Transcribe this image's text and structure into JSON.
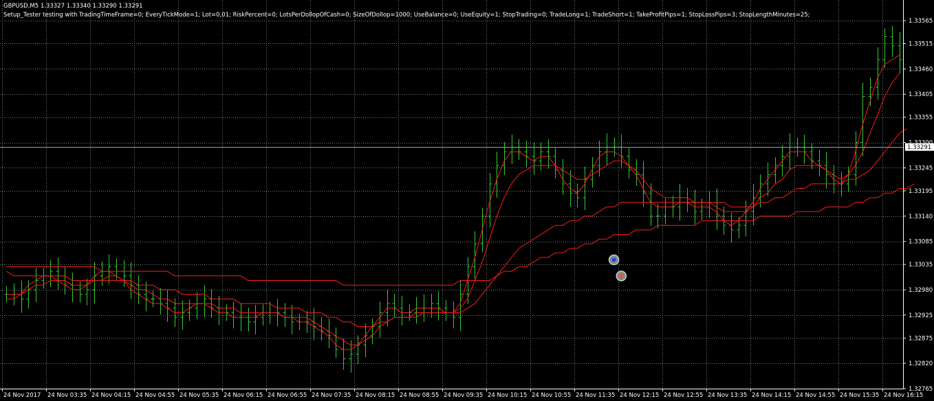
{
  "header": {
    "symbol_line": "GBPUSD,M5  1.33327 1.33340 1.33290 1.33291",
    "params_line": "Setup_Tester testing with TradingTimeFrame=0; EveryTickMode=1; Lot=0,01; RiskPercent=0; LotsPerDollopOfCash=0; SizeOfDollop=1000; UseBalance=0; UseEquity=1; StopTrading=0; TradeLong=1; TradeShort=1; TakeProfitPips=1; StopLossPips=3; StopLengthMinutes=25;"
  },
  "colors": {
    "background": "#000000",
    "bars": "#33cc33",
    "ma": "#ff1a1a",
    "grid": "#6f7f7f",
    "axis": "#ffffff",
    "price_line": "#9aa0a0",
    "price_tag_bg": "#ffffff"
  },
  "chart_data": {
    "type": "line",
    "symbol": "GBPUSD",
    "timeframe": "M5",
    "ohlc_last": {
      "open": 1.33327,
      "high": 1.3334,
      "low": 1.3329,
      "close": 1.33291
    },
    "current_price": "1.33291",
    "y_ticks": [
      "1.33565",
      "1.33515",
      "1.33460",
      "1.33405",
      "1.33355",
      "1.33300",
      "1.33245",
      "1.33195",
      "1.33140",
      "1.33085",
      "1.33035",
      "1.32980",
      "1.32925",
      "1.32875",
      "1.32820",
      "1.32765"
    ],
    "ylim": [
      1.32765,
      1.33565
    ],
    "x_ticks": [
      "24 Nov 2017",
      "24 Nov 03:35",
      "24 Nov 04:15",
      "24 Nov 04:55",
      "24 Nov 05:35",
      "24 Nov 06:15",
      "24 Nov 06:55",
      "24 Nov 07:35",
      "24 Nov 08:15",
      "24 Nov 08:55",
      "24 Nov 09:35",
      "24 Nov 10:15",
      "24 Nov 10:55",
      "24 Nov 11:35",
      "24 Nov 12:15",
      "24 Nov 12:55",
      "24 Nov 13:35",
      "24 Nov 14:15",
      "24 Nov 14:55",
      "24 Nov 15:35",
      "24 Nov 16:15"
    ],
    "bar_step_minutes": 5,
    "grid": true,
    "series": [
      {
        "kind": "price",
        "values": [
          1.3297,
          1.3297,
          1.3296,
          1.3298,
          1.33,
          1.3301,
          1.3302,
          1.3301,
          1.3299,
          1.3298,
          1.3297,
          1.3298,
          1.3301,
          1.3302,
          1.3303,
          1.3302,
          1.3301,
          1.3299,
          1.3297,
          1.3296,
          1.3296,
          1.3295,
          1.3294,
          1.3292,
          1.3293,
          1.3294,
          1.3295,
          1.3296,
          1.3294,
          1.3293,
          1.3293,
          1.3292,
          1.3292,
          1.3291,
          1.3292,
          1.3293,
          1.3293,
          1.3293,
          1.3292,
          1.3291,
          1.3291,
          1.3291,
          1.329,
          1.3289,
          1.3288,
          1.3285,
          1.3283,
          1.3284,
          1.3286,
          1.3288,
          1.329,
          1.3293,
          1.3295,
          1.3294,
          1.3293,
          1.3293,
          1.3294,
          1.3294,
          1.3295,
          1.3294,
          1.3293,
          1.3292,
          1.3297,
          1.3303,
          1.3308,
          1.3314,
          1.3321,
          1.3325,
          1.3328,
          1.3329,
          1.3328,
          1.3327,
          1.3326,
          1.3328,
          1.3327,
          1.3324,
          1.3321,
          1.3319,
          1.3318,
          1.3322,
          1.3325,
          1.3328,
          1.3329,
          1.3329,
          1.3327,
          1.3324,
          1.3323,
          1.3319,
          1.3314,
          1.3314,
          1.3316,
          1.3316,
          1.3318,
          1.3317,
          1.3315,
          1.3316,
          1.3317,
          1.3314,
          1.3312,
          1.3311,
          1.3312,
          1.3315,
          1.3318,
          1.3321,
          1.3323,
          1.3325,
          1.3327,
          1.3329,
          1.3329,
          1.3328,
          1.3326,
          1.3325,
          1.3323,
          1.3321,
          1.3321,
          1.3323,
          1.333,
          1.334,
          1.3342,
          1.3348,
          1.3353,
          1.3351,
          1.3348
        ]
      },
      {
        "kind": "moving_average",
        "name": "",
        "values": [
          1.3296,
          1.3296,
          1.3297,
          1.3299,
          1.33,
          1.3301,
          1.3301,
          1.33,
          1.3299,
          1.3298,
          1.3298,
          1.3299,
          1.3301,
          1.3302,
          1.3302,
          1.3301,
          1.33,
          1.3298,
          1.3297,
          1.3296,
          1.3295,
          1.3295,
          1.3294,
          1.3293,
          1.3293,
          1.3294,
          1.3295,
          1.3295,
          1.3294,
          1.3293,
          1.3293,
          1.3292,
          1.3292,
          1.3292,
          1.3292,
          1.3293,
          1.3293,
          1.3293,
          1.3292,
          1.3292,
          1.3291,
          1.3291,
          1.329,
          1.3289,
          1.3288,
          1.3286,
          1.3285,
          1.3285,
          1.3286,
          1.3288,
          1.329,
          1.3292,
          1.3294,
          1.3294,
          1.3293,
          1.3293,
          1.3294,
          1.3294,
          1.3294,
          1.3294,
          1.3293,
          1.3293,
          1.3295,
          1.33,
          1.3305,
          1.3311,
          1.3317,
          1.3322,
          1.3326,
          1.3328,
          1.3328,
          1.3327,
          1.3326,
          1.3327,
          1.3327,
          1.3325,
          1.3322,
          1.332,
          1.3319,
          1.3321,
          1.3324,
          1.3327,
          1.3328,
          1.3328,
          1.3327,
          1.3325,
          1.3323,
          1.332,
          1.3317,
          1.3316,
          1.3316,
          1.3316,
          1.3317,
          1.3317,
          1.3316,
          1.3316,
          1.3316,
          1.3315,
          1.3313,
          1.3312,
          1.3313,
          1.3315,
          1.3317,
          1.332,
          1.3322,
          1.3324,
          1.3326,
          1.3328,
          1.3328,
          1.3328,
          1.3326,
          1.3325,
          1.3324,
          1.3322,
          1.3321,
          1.3323,
          1.3328,
          1.3334,
          1.3339,
          1.3344,
          1.3347,
          1.3348,
          1.3349
        ]
      },
      {
        "kind": "moving_average",
        "name": "",
        "values": [
          1.3297,
          1.3297,
          1.3297,
          1.3298,
          1.3299,
          1.3299,
          1.33,
          1.33,
          1.33,
          1.3299,
          1.3299,
          1.3299,
          1.33,
          1.33,
          1.3301,
          1.3301,
          1.33,
          1.3299,
          1.3298,
          1.3298,
          1.3297,
          1.3296,
          1.3296,
          1.3295,
          1.3295,
          1.3295,
          1.3295,
          1.3295,
          1.3295,
          1.3294,
          1.3294,
          1.3294,
          1.3293,
          1.3293,
          1.3293,
          1.3293,
          1.3293,
          1.3293,
          1.3292,
          1.3292,
          1.3292,
          1.3292,
          1.3291,
          1.329,
          1.3289,
          1.3288,
          1.3287,
          1.3286,
          1.3286,
          1.3287,
          1.3288,
          1.329,
          1.3291,
          1.3292,
          1.3292,
          1.3292,
          1.3293,
          1.3293,
          1.3293,
          1.3293,
          1.3293,
          1.3293,
          1.3294,
          1.3296,
          1.33,
          1.3304,
          1.3309,
          1.3314,
          1.3318,
          1.3321,
          1.3323,
          1.3324,
          1.3325,
          1.3325,
          1.3325,
          1.3325,
          1.3324,
          1.3323,
          1.3322,
          1.3322,
          1.3323,
          1.3324,
          1.3325,
          1.3326,
          1.3326,
          1.3325,
          1.3324,
          1.3322,
          1.332,
          1.3319,
          1.3318,
          1.3318,
          1.3318,
          1.3318,
          1.3317,
          1.3317,
          1.3317,
          1.3316,
          1.3315,
          1.3315,
          1.3315,
          1.3315,
          1.3316,
          1.3318,
          1.3319,
          1.3321,
          1.3322,
          1.3324,
          1.3325,
          1.3325,
          1.3325,
          1.3325,
          1.3324,
          1.3323,
          1.3322,
          1.3323,
          1.3325,
          1.3328,
          1.3332,
          1.3336,
          1.334,
          1.3343,
          1.3345
        ]
      },
      {
        "kind": "moving_average",
        "name": "",
        "values": [
          1.3302,
          1.3301,
          1.3301,
          1.3301,
          1.3301,
          1.3301,
          1.3301,
          1.3301,
          1.3301,
          1.33,
          1.33,
          1.33,
          1.33,
          1.33,
          1.33,
          1.33,
          1.33,
          1.33,
          1.3299,
          1.3299,
          1.3299,
          1.3298,
          1.3298,
          1.3298,
          1.3297,
          1.3297,
          1.3297,
          1.3297,
          1.3296,
          1.3296,
          1.3296,
          1.3296,
          1.3295,
          1.3295,
          1.3295,
          1.3295,
          1.3295,
          1.3294,
          1.3294,
          1.3294,
          1.3294,
          1.3293,
          1.3293,
          1.3293,
          1.3292,
          1.3292,
          1.3291,
          1.3291,
          1.329,
          1.329,
          1.329,
          1.3291,
          1.3291,
          1.3292,
          1.3292,
          1.3292,
          1.3292,
          1.3293,
          1.3293,
          1.3293,
          1.3293,
          1.3293,
          1.3293,
          1.3294,
          1.3295,
          1.3297,
          1.3299,
          1.3301,
          1.3303,
          1.3305,
          1.3307,
          1.3308,
          1.3309,
          1.331,
          1.3311,
          1.3312,
          1.3312,
          1.3313,
          1.3313,
          1.3314,
          1.3314,
          1.3315,
          1.3316,
          1.3316,
          1.3317,
          1.3317,
          1.3317,
          1.3317,
          1.3317,
          1.3317,
          1.3317,
          1.3317,
          1.3317,
          1.3317,
          1.3317,
          1.3317,
          1.3317,
          1.3317,
          1.3317,
          1.3316,
          1.3316,
          1.3316,
          1.3316,
          1.3317,
          1.3317,
          1.3318,
          1.3318,
          1.3319,
          1.332,
          1.332,
          1.3321,
          1.3321,
          1.3321,
          1.3321,
          1.3321,
          1.3322,
          1.3322,
          1.3323,
          1.3324,
          1.3326,
          1.3328,
          1.333,
          1.3332,
          1.3333
        ]
      },
      {
        "kind": "moving_average",
        "name": "",
        "values": [
          1.3303,
          1.3303,
          1.3303,
          1.3303,
          1.3303,
          1.3303,
          1.3303,
          1.3303,
          1.3303,
          1.3303,
          1.3303,
          1.3303,
          1.3303,
          1.3302,
          1.3302,
          1.3302,
          1.3302,
          1.3302,
          1.3302,
          1.3302,
          1.3302,
          1.3302,
          1.3302,
          1.3301,
          1.3301,
          1.3301,
          1.3301,
          1.3301,
          1.3301,
          1.3301,
          1.3301,
          1.3301,
          1.3301,
          1.33,
          1.33,
          1.33,
          1.33,
          1.33,
          1.33,
          1.33,
          1.33,
          1.33,
          1.33,
          1.33,
          1.33,
          1.33,
          1.3299,
          1.3299,
          1.3299,
          1.3299,
          1.3299,
          1.3299,
          1.3299,
          1.3299,
          1.3299,
          1.3299,
          1.3299,
          1.3299,
          1.3299,
          1.3299,
          1.3299,
          1.3299,
          1.33,
          1.33,
          1.33,
          1.33,
          1.33,
          1.3301,
          1.3302,
          1.3302,
          1.3303,
          1.3303,
          1.3304,
          1.3305,
          1.3305,
          1.3306,
          1.3306,
          1.3307,
          1.3307,
          1.3308,
          1.3308,
          1.3309,
          1.3309,
          1.331,
          1.331,
          1.331,
          1.3311,
          1.3311,
          1.3311,
          1.3312,
          1.3312,
          1.3312,
          1.3312,
          1.3312,
          1.3312,
          1.3313,
          1.3313,
          1.3313,
          1.3313,
          1.3313,
          1.3313,
          1.3313,
          1.3313,
          1.3314,
          1.3314,
          1.3314,
          1.3314,
          1.3314,
          1.3315,
          1.3315,
          1.3315,
          1.3315,
          1.3316,
          1.3316,
          1.3316,
          1.3316,
          1.3317,
          1.3317,
          1.3318,
          1.3318,
          1.3319,
          1.3319,
          1.332,
          1.332,
          1.3321
        ]
      }
    ],
    "trade_markers": [
      {
        "bar": 83,
        "price": 1.33045,
        "kind": "buy"
      },
      {
        "bar": 84,
        "price": 1.3301,
        "kind": "close"
      }
    ]
  }
}
